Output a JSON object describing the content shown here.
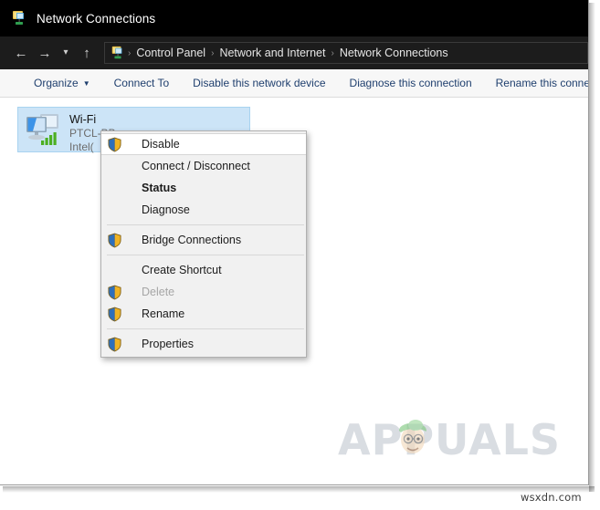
{
  "window": {
    "title": "Network Connections",
    "title_icon": "network-connections-icon"
  },
  "nav": {
    "back_icon": "back-arrow-icon",
    "forward_icon": "forward-arrow-icon",
    "recent_icon": "chevron-down-icon",
    "up_icon": "up-arrow-icon",
    "address_icon": "network-connections-icon",
    "breadcrumbs": [
      {
        "label": "Control Panel"
      },
      {
        "label": "Network and Internet"
      },
      {
        "label": "Network Connections"
      }
    ],
    "separator": "›"
  },
  "toolbar": {
    "items": [
      {
        "label": "Organize",
        "has_caret": true
      },
      {
        "label": "Connect To",
        "has_caret": false
      },
      {
        "label": "Disable this network device",
        "has_caret": false
      },
      {
        "label": "Diagnose this connection",
        "has_caret": false
      },
      {
        "label": "Rename this conne",
        "has_caret": false
      }
    ],
    "caret": "▼"
  },
  "connection": {
    "icon": "network-adapter-icon",
    "name": "Wi-Fi",
    "network": "PTCL-BB",
    "adapter": "Intel(",
    "selected": true
  },
  "context_menu": {
    "items": [
      {
        "label": "Disable",
        "shield": true,
        "bold": false,
        "disabled": false,
        "highlight": true
      },
      {
        "label": "Connect / Disconnect",
        "shield": false,
        "bold": false,
        "disabled": false,
        "highlight": false
      },
      {
        "label": "Status",
        "shield": false,
        "bold": true,
        "disabled": false,
        "highlight": false
      },
      {
        "label": "Diagnose",
        "shield": false,
        "bold": false,
        "disabled": false,
        "highlight": false
      },
      {
        "separator": true
      },
      {
        "label": "Bridge Connections",
        "shield": true,
        "bold": false,
        "disabled": false,
        "highlight": false
      },
      {
        "separator": true
      },
      {
        "label": "Create Shortcut",
        "shield": false,
        "bold": false,
        "disabled": false,
        "highlight": false
      },
      {
        "label": "Delete",
        "shield": true,
        "bold": false,
        "disabled": true,
        "highlight": false
      },
      {
        "label": "Rename",
        "shield": true,
        "bold": false,
        "disabled": false,
        "highlight": false
      },
      {
        "separator": true
      },
      {
        "label": "Properties",
        "shield": true,
        "bold": false,
        "disabled": false,
        "highlight": false
      }
    ]
  },
  "watermarks": {
    "appuals": "APPUALS",
    "wsxdn": "wsxdn.com"
  },
  "colors": {
    "titlebar_bg": "#000000",
    "navbar_bg": "#1c1c1c",
    "toolbar_bg": "#f7f7f7",
    "toolbar_text": "#1f3f6e",
    "selection_bg": "#cce4f7",
    "menu_bg": "#f1f1f1",
    "shield_blue": "#2e6fbb",
    "shield_gold": "#f0b323",
    "signal_green": "#4caf22"
  }
}
